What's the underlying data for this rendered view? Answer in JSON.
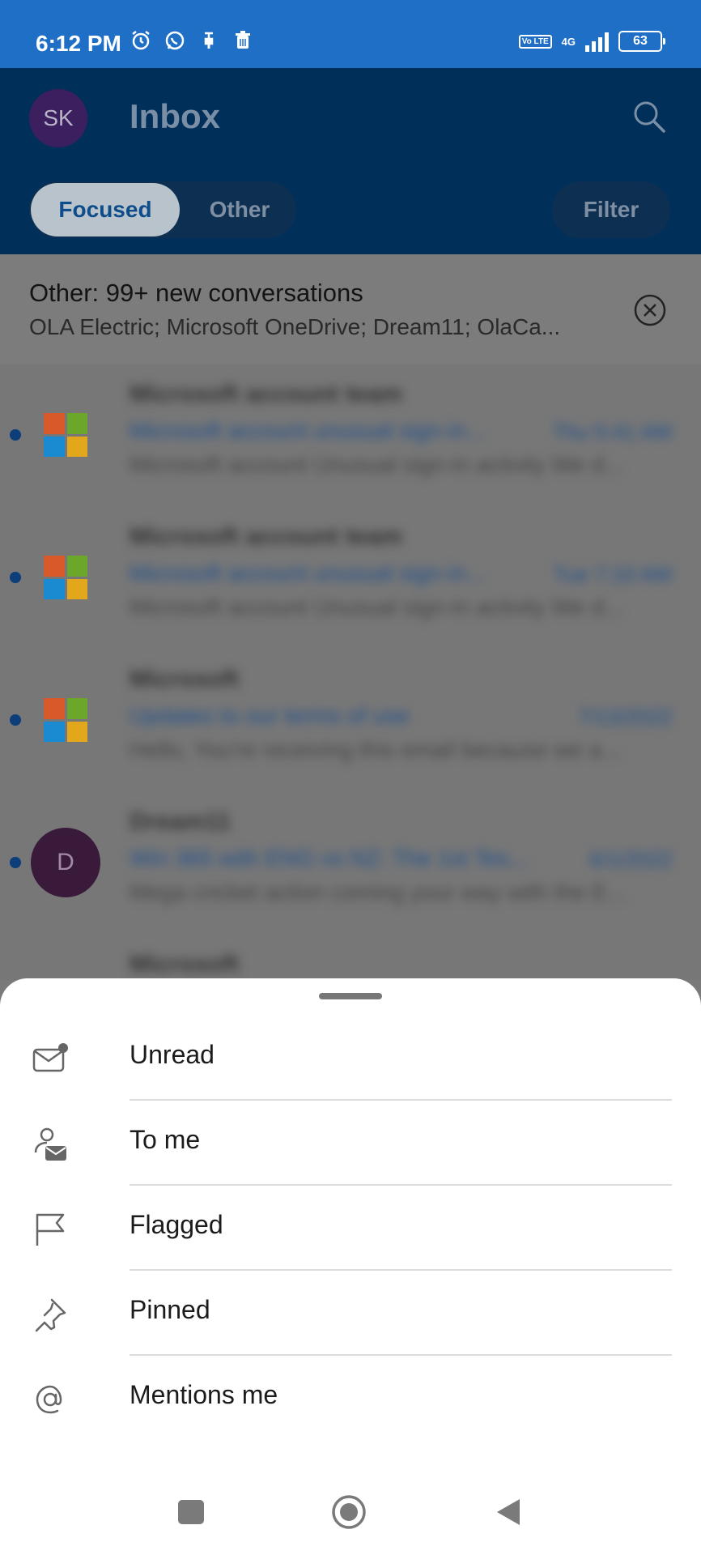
{
  "status_bar": {
    "time": "6:12 PM",
    "volte": "Vo LTE",
    "network": "4G",
    "battery": "63"
  },
  "header": {
    "avatar_initials": "SK",
    "title": "Inbox",
    "tabs": [
      {
        "label": "Focused",
        "selected": true
      },
      {
        "label": "Other",
        "selected": false
      }
    ],
    "filter_label": "Filter"
  },
  "banner": {
    "title": "Other: 99+ new conversations",
    "subtitle": "OLA Electric; Microsoft OneDrive; Dream11; OlaCa..."
  },
  "messages": [
    {
      "sender": "Microsoft account team",
      "subject": "Microsoft account unusual sign-in...",
      "date": "Thu 5:41 AM",
      "preview": "Microsoft account Unusual sign-in activity We d...",
      "unread": true,
      "avatar": "microsoft-logo"
    },
    {
      "sender": "Microsoft account team",
      "subject": "Microsoft account unusual sign-in...",
      "date": "Tue 7:10 AM",
      "preview": "Microsoft account Unusual sign-in activity We d...",
      "unread": true,
      "avatar": "microsoft-logo"
    },
    {
      "sender": "Microsoft",
      "subject": "Updates to our terms of use",
      "date": "7/13/2022",
      "preview": "Hello, You're receiving this email because we a...",
      "unread": true,
      "avatar": "microsoft-logo"
    },
    {
      "sender": "Dream11",
      "subject": "Win 365 with ENG vs NZ: The 1st Tes...",
      "date": "6/1/2022",
      "preview": "Mega cricket action coming your way with the E...",
      "unread": true,
      "avatar_initial": "D"
    },
    {
      "sender": "Microsoft"
    }
  ],
  "filter_sheet": {
    "options": [
      {
        "label": "Unread",
        "icon": "mail-unread-icon"
      },
      {
        "label": "To me",
        "icon": "person-mail-icon"
      },
      {
        "label": "Flagged",
        "icon": "flag-icon"
      },
      {
        "label": "Pinned",
        "icon": "pin-icon"
      },
      {
        "label": "Mentions me",
        "icon": "at-icon"
      }
    ]
  },
  "colors": {
    "status_bar": "#1f6fc7",
    "header": "#00305a",
    "accent": "#0f6cbd",
    "ms_red": "#d85a2b",
    "ms_green": "#6ba82a",
    "ms_blue": "#1a8bd1",
    "ms_yellow": "#e3a71b"
  }
}
